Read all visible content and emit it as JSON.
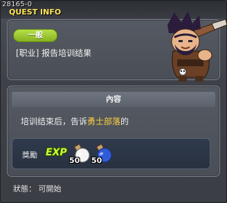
{
  "window": {
    "quest_id": "28165-0",
    "title": "QUEST INFO",
    "close_label": "×"
  },
  "quest": {
    "category_badge": "一般",
    "name": "[职业] 报告培训结果"
  },
  "content": {
    "section_title": "內容",
    "description_prefix": "培训结束后，告诉",
    "description_highlight": "勇士部落",
    "description_suffix": "的"
  },
  "rewards": {
    "label": "獎勵",
    "exp_label": "EXP",
    "items": [
      {
        "icon": "white-potion-icon",
        "count": "50"
      },
      {
        "icon": "blue-potion-icon",
        "count": "50"
      }
    ]
  },
  "status": {
    "text": "狀態： 可開始"
  },
  "colors": {
    "accent_yellow": "#ffe45a",
    "badge_green": "#9ccc35",
    "highlight": "#ffd23a"
  }
}
